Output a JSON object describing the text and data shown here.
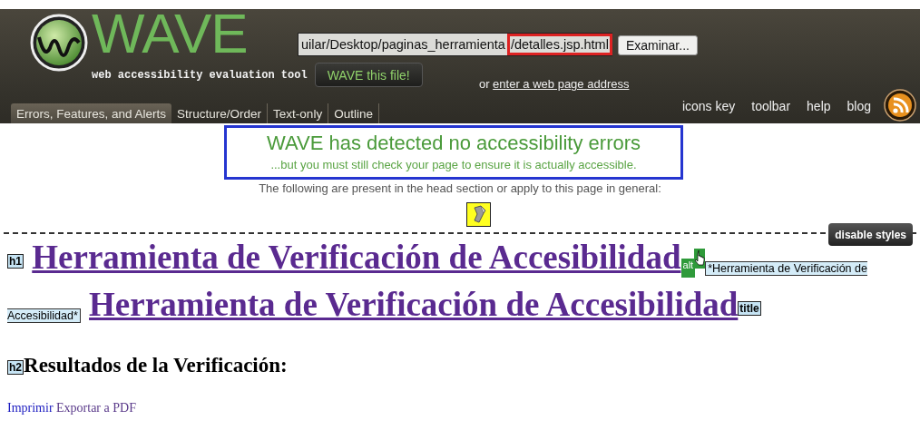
{
  "header": {
    "logo_text": "WAVE",
    "tagline": "web accessibility evaluation tool",
    "file_field": {
      "value": "uilar/Desktop/paginas_herramienta",
      "highlighted_value": "/detalles.jsp.html"
    },
    "browse_button": "Examinar...",
    "submit_button": "WAVE this file!",
    "address_prompt": {
      "text": "or",
      "link": "enter a web page address"
    },
    "tabs": [
      {
        "label": "Errors, Features, and Alerts",
        "selected": true
      },
      {
        "label": "Structure/Order",
        "selected": false
      },
      {
        "label": "Text-only",
        "selected": false
      },
      {
        "label": "Outline",
        "selected": false
      }
    ],
    "links": [
      "icons key",
      "toolbar",
      "help",
      "blog"
    ]
  },
  "notice": {
    "title": "WAVE has detected no accessibility errors",
    "subtitle": "...but you must still check your page to ensure it is actually accessible.",
    "general_note": "The following are present in the head section or apply to this page in general:"
  },
  "disable_styles_button": "disable styles",
  "page": {
    "heading_1": {
      "marker": "h1",
      "text": "Herramienta de Verificación de Accesibilidad",
      "alt_marker": "alt",
      "alt_text": "*Herramienta de Verificación de Accesibilidad*",
      "text_2": "Herramienta de Verificación de Accesibilidad",
      "title_marker": "title"
    },
    "heading_2": {
      "marker": "h2",
      "text": "Resultados de la Verificación:"
    },
    "links": [
      {
        "label": "Imprimir",
        "visited": false
      },
      {
        "label": "Exportar a PDF",
        "visited": true
      }
    ]
  }
}
